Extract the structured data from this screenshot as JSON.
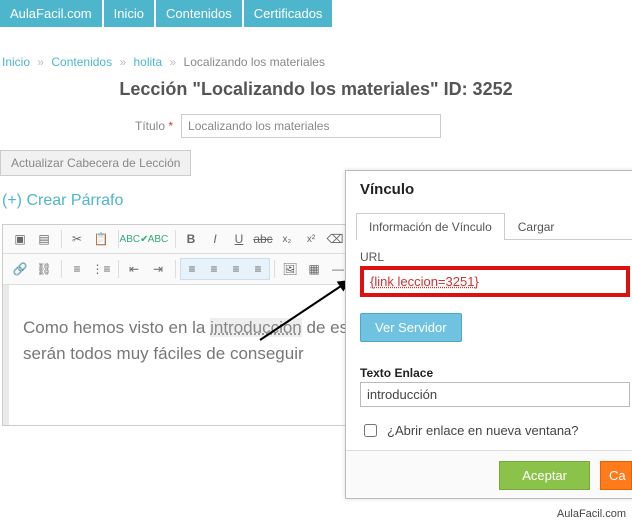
{
  "nav": {
    "brand": "AulaFacil.com",
    "items": [
      "Inicio",
      "Contenidos",
      "Certificados"
    ]
  },
  "breadcrumb": {
    "items": [
      "Inicio",
      "Contenidos",
      "holita"
    ],
    "current": "Localizando los materiales",
    "sep": "»"
  },
  "page": {
    "title_prefix": "Lección \"",
    "title_name": "Localizando los materiales",
    "title_suffix": "\"   ID: 3252"
  },
  "form": {
    "titulo_label": "Título",
    "required_mark": "*",
    "titulo_value": "Localizando los materiales",
    "update_button": "Actualizar Cabecera de Lección"
  },
  "create_paragraph": "(+) Crear Párrafo",
  "editor": {
    "body_pre": "Como hemos visto en la ",
    "body_link": "introducción",
    "body_post": " de este utilizar serán todos muy fáciles de conseguir"
  },
  "dialog": {
    "title": "Vínculo",
    "tab_info": "Información de Vínculo",
    "tab_upload": "Cargar",
    "url_label": "URL",
    "url_value": "{link leccion=3251}",
    "ver_servidor": "Ver Servidor",
    "texto_label": "Texto Enlace",
    "texto_value": "introducción",
    "open_new": "¿Abrir enlace en nueva ventana?",
    "accept": "Aceptar",
    "cancel": "Ca"
  },
  "watermark": "AulaFacil.com"
}
